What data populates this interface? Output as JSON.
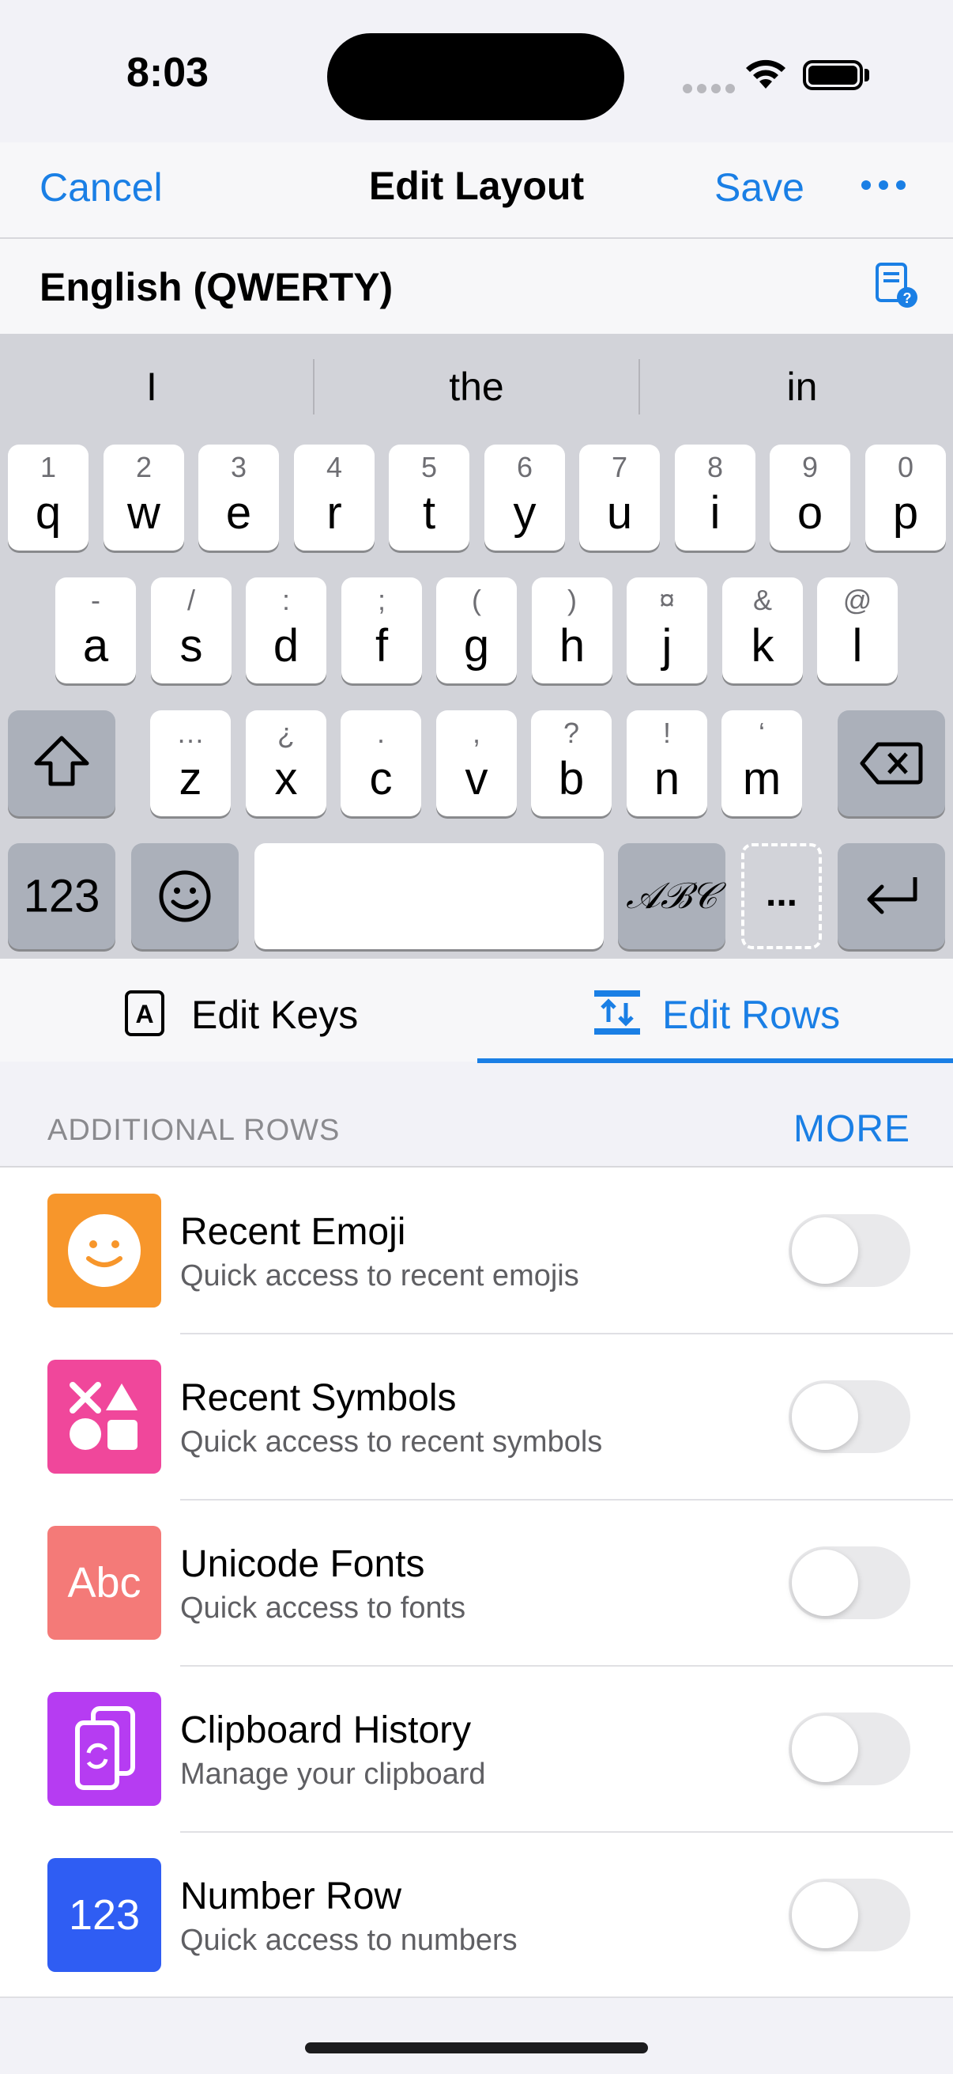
{
  "status": {
    "time": "8:03"
  },
  "nav": {
    "cancel": "Cancel",
    "title": "Edit Layout",
    "save": "Save",
    "more_icon": "ellipsis-icon"
  },
  "layout": {
    "name": "English (QWERTY)",
    "help_icon": "help-book-icon"
  },
  "keyboard": {
    "suggestions": [
      "I",
      "the",
      "in"
    ],
    "row1": [
      {
        "alt": "1",
        "key": "q"
      },
      {
        "alt": "2",
        "key": "w"
      },
      {
        "alt": "3",
        "key": "e"
      },
      {
        "alt": "4",
        "key": "r"
      },
      {
        "alt": "5",
        "key": "t"
      },
      {
        "alt": "6",
        "key": "y"
      },
      {
        "alt": "7",
        "key": "u"
      },
      {
        "alt": "8",
        "key": "i"
      },
      {
        "alt": "9",
        "key": "o"
      },
      {
        "alt": "0",
        "key": "p"
      }
    ],
    "row2": [
      {
        "alt": "-",
        "key": "a"
      },
      {
        "alt": "/",
        "key": "s"
      },
      {
        "alt": ":",
        "key": "d"
      },
      {
        "alt": ";",
        "key": "f"
      },
      {
        "alt": "(",
        "key": "g"
      },
      {
        "alt": ")",
        "key": "h"
      },
      {
        "alt": "¤",
        "key": "j"
      },
      {
        "alt": "&",
        "key": "k"
      },
      {
        "alt": "@",
        "key": "l"
      }
    ],
    "row3": [
      {
        "alt": "…",
        "key": "z"
      },
      {
        "alt": "¿",
        "key": "x"
      },
      {
        "alt": ".",
        "key": "c"
      },
      {
        "alt": ",",
        "key": "v"
      },
      {
        "alt": "?",
        "key": "b"
      },
      {
        "alt": "!",
        "key": "n"
      },
      {
        "alt": "‘",
        "key": "m"
      }
    ],
    "numbers_key": "123",
    "font_key": "𝒜ℬ𝒞",
    "more_key": "..."
  },
  "tabs": {
    "edit_keys": "Edit Keys",
    "edit_rows": "Edit Rows",
    "active": "edit_rows"
  },
  "additional_rows": {
    "header": "ADDITIONAL ROWS",
    "more": "MORE",
    "items": [
      {
        "title": "Recent Emoji",
        "subtitle": "Quick access to recent emojis",
        "icon": "smiley-icon",
        "color": "#f7962b",
        "enabled": false
      },
      {
        "title": "Recent Symbols",
        "subtitle": "Quick access to recent symbols",
        "icon": "shapes-icon",
        "color": "#f0479b",
        "enabled": false
      },
      {
        "title": "Unicode Fonts",
        "subtitle": "Quick access to fonts",
        "icon": "abc-icon",
        "icon_text": "Abc",
        "color": "#f47a78",
        "enabled": false
      },
      {
        "title": "Clipboard History",
        "subtitle": "Manage your clipboard",
        "icon": "clipboard-icon",
        "color": "#b63cf2",
        "enabled": false
      },
      {
        "title": "Number Row",
        "subtitle": "Quick access to numbers",
        "icon": "number-icon",
        "icon_text": "123",
        "color": "#2f5df3",
        "enabled": false
      }
    ]
  }
}
